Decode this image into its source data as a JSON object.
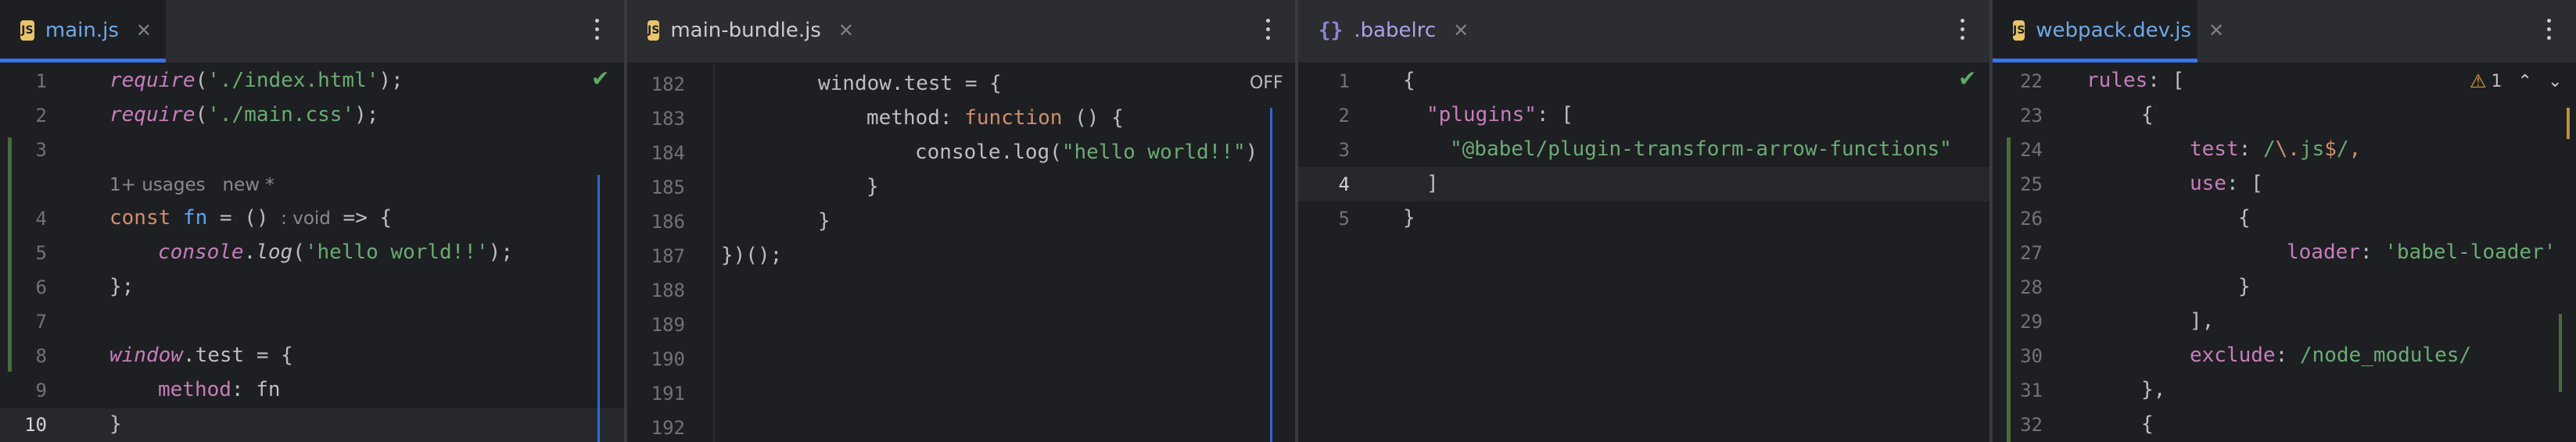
{
  "panes": [
    {
      "tab": {
        "label": "main.js",
        "icon": "js-icon",
        "icon_text": "JS",
        "active": true
      },
      "status_check": "✔",
      "current_line": "10",
      "inlay": {
        "usages": "1+ usages",
        "author": "new *",
        "return_type": ": void"
      },
      "lines": [
        {
          "num": "1"
        },
        {
          "num": "2"
        },
        {
          "num": "3"
        },
        {
          "num": "4"
        },
        {
          "num": "5"
        },
        {
          "num": "6"
        },
        {
          "num": "7"
        },
        {
          "num": "8"
        },
        {
          "num": "9"
        },
        {
          "num": "10"
        }
      ],
      "code": {
        "l1_fn": "require",
        "l1_arg": "'./index.html'",
        "l1_end": ");",
        "l2_fn": "require",
        "l2_arg": "'./main.css'",
        "l2_end": ");",
        "l4_kw": "const",
        "l4_name": "fn",
        "l4_rest1": " = () ",
        "l4_rest2": " => {",
        "l5_obj": "console",
        "l5_method": "log",
        "l5_arg": "'hello world!!'",
        "l5_end": ");",
        "l6": "};",
        "l8_glob": "window",
        "l8_prop": ".test",
        "l8_rest": " = {",
        "l9_key": "method",
        "l9_val": "fn",
        "l10": "}"
      }
    },
    {
      "tab": {
        "label": "main-bundle.js",
        "icon": "js-icon",
        "icon_text": "JS",
        "active": false
      },
      "off_label": "OFF",
      "lines": [
        {
          "num": "182"
        },
        {
          "num": "183"
        },
        {
          "num": "184"
        },
        {
          "num": "185"
        },
        {
          "num": "186"
        },
        {
          "num": "187"
        },
        {
          "num": "188"
        },
        {
          "num": "189"
        },
        {
          "num": "190"
        },
        {
          "num": "191"
        },
        {
          "num": "192"
        }
      ],
      "code": {
        "l182": "window.test = {",
        "l183_key": "method: ",
        "l183_kw": "function",
        "l183_rest": " () {",
        "l184_pre": "console.log(",
        "l184_str": "\"hello world!!\"",
        "l184_end": ")",
        "l185": "}",
        "l186": "}",
        "l187": "})();"
      }
    },
    {
      "tab": {
        "label": ".babelrc",
        "icon": "json-icon",
        "icon_text": "{}",
        "active": false
      },
      "status_check": "✔",
      "current_line": "4",
      "lines": [
        {
          "num": "1"
        },
        {
          "num": "2"
        },
        {
          "num": "3"
        },
        {
          "num": "4"
        },
        {
          "num": "5"
        }
      ],
      "code": {
        "l1": "{",
        "l2_key": "\"plugins\"",
        "l2_rest": ": [",
        "l3_str": "\"@babel/plugin-transform-arrow-functions\"",
        "l4": "]",
        "l5": "}"
      }
    },
    {
      "tab": {
        "label": "webpack.dev.js",
        "icon": "js-icon",
        "icon_text": "JS",
        "active": true
      },
      "warnings": {
        "count": "1",
        "icon": "warning-icon"
      },
      "lines": [
        {
          "num": "22"
        },
        {
          "num": "23"
        },
        {
          "num": "24"
        },
        {
          "num": "25"
        },
        {
          "num": "26"
        },
        {
          "num": "27"
        },
        {
          "num": "28"
        },
        {
          "num": "29"
        },
        {
          "num": "30"
        },
        {
          "num": "31"
        },
        {
          "num": "32"
        }
      ],
      "code": {
        "l22_key": "rules",
        "l22_rest": ": [",
        "l23": "{",
        "l24_key": "test",
        "l24_colon": ": ",
        "l24_r1": "/",
        "l24_esc": "\\.",
        "l24_r2": "js",
        "l24_dollar": "$",
        "l24_r3": "/",
        "l24_end": ",",
        "l25_key": "use",
        "l25_rest": ": [",
        "l26": "{",
        "l27_key": "loader",
        "l27_colon": ": ",
        "l27_str": "'babel-loader'",
        "l28": "}",
        "l29": "],",
        "l30_key": "exclude",
        "l30_colon": ": ",
        "l30_r1": "/",
        "l30_r2": "node_modules",
        "l30_r3": "/",
        "l31": "},",
        "l32": "{"
      }
    }
  ],
  "colors": {
    "accent": "#3574f0",
    "background": "#1e1f22",
    "tabbar": "#2b2d30"
  }
}
